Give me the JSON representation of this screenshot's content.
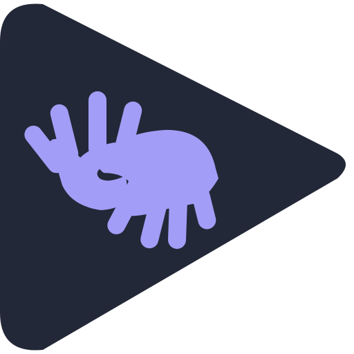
{
  "icon": {
    "name": "sign-language-play-icon",
    "description_parts": [
      "play-triangle",
      "left-hand",
      "right-hand"
    ],
    "colors": {
      "background": "#ffffff",
      "triangle": "#232838",
      "hands": "#a29ef7"
    }
  }
}
